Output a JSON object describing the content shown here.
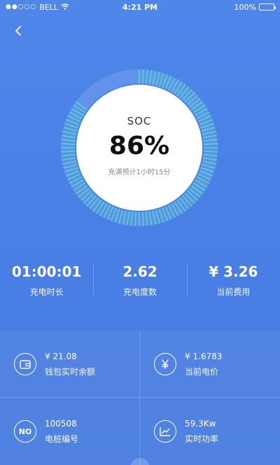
{
  "status_bar": {
    "signal": "●●○○○",
    "carrier": "BELL",
    "time": "4:21 PM",
    "battery": "100%"
  },
  "gauge": {
    "label": "SOC",
    "value": "86%",
    "fraction": 0.86,
    "subtitle": "充满预计1小时15分"
  },
  "stats": [
    {
      "value": "01:00:01",
      "label": "充电时长"
    },
    {
      "value": "2.62",
      "label": "充电度数"
    },
    {
      "value": "¥ 3.26",
      "label": "当前费用"
    }
  ],
  "info": [
    {
      "icon": "wallet-icon",
      "value": "¥ 21.08",
      "label": "钱包实时余额"
    },
    {
      "icon": "yen-icon",
      "value": "¥ 1.6783",
      "label": "当前电价"
    },
    {
      "icon": "no-icon",
      "icon_text": "NO",
      "value": "100508",
      "label": "电桩编号"
    },
    {
      "icon": "chart-icon",
      "value": "59.3Kw",
      "label": "实时功率"
    }
  ],
  "colors": {
    "accent": "#4fd8c8",
    "background": "#4a80e6"
  }
}
